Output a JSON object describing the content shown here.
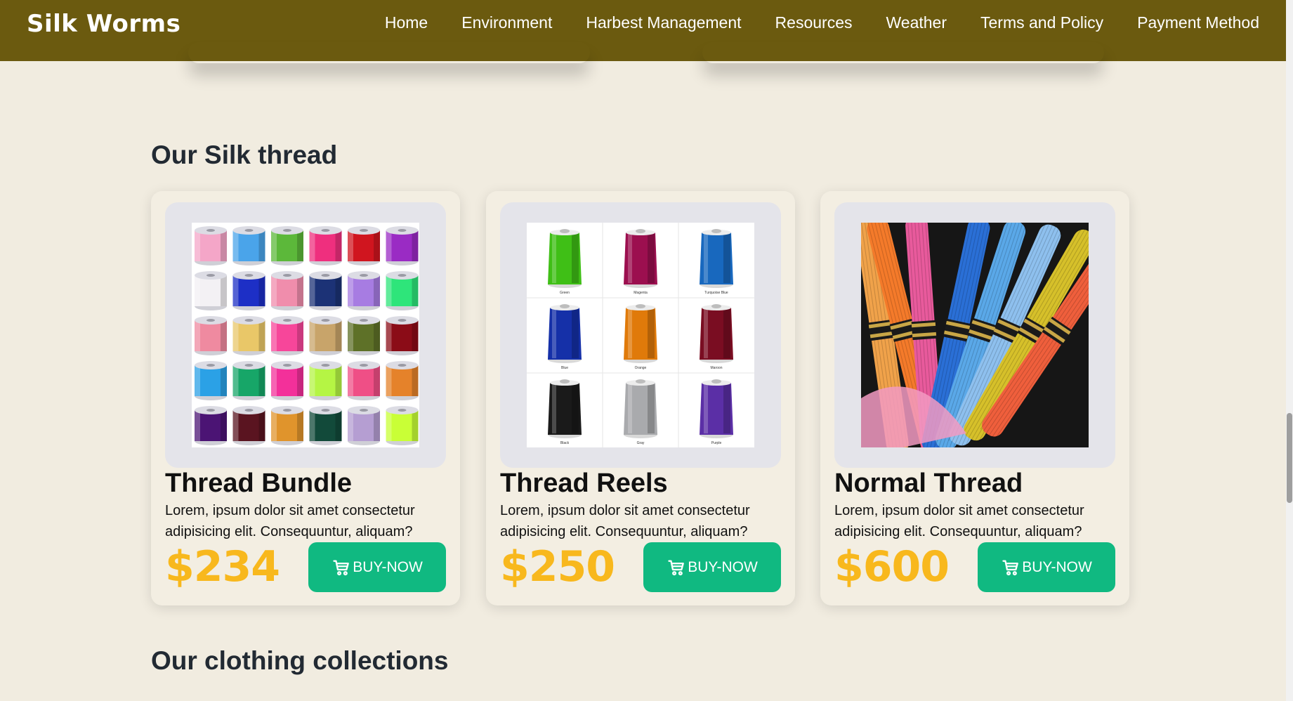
{
  "navbar": {
    "brand": "Silk Worms",
    "links": [
      "Home",
      "Environment",
      "Harbest Management",
      "Resources",
      "Weather",
      "Terms and Policy",
      "Payment Method"
    ]
  },
  "silk_section": {
    "title": "Our Silk thread",
    "products": [
      {
        "name": "Thread Bundle",
        "description": "Lorem, ipsum dolor sit amet consectetur adipisicing elit. Consequuntur, aliquam?",
        "price": "$234",
        "button_label": "BUY-NOW"
      },
      {
        "name": "Thread Reels",
        "description": "Lorem, ipsum dolor sit amet consectetur adipisicing elit. Consequuntur, aliquam?",
        "price": "$250",
        "button_label": "BUY-NOW"
      },
      {
        "name": "Normal Thread",
        "description": "Lorem, ipsum dolor sit amet consectetur adipisicing elit. Consequuntur, aliquam?",
        "price": "$600",
        "button_label": "BUY-NOW"
      }
    ]
  },
  "reel_labels": [
    "Green",
    "Magenta",
    "Turquoise Blue",
    "Blue",
    "Orange",
    "Maroon",
    "Black",
    "Gray",
    "Purple"
  ],
  "clothing_section": {
    "title": "Our clothing collections"
  },
  "colors": {
    "navbar": "#6b5a0f",
    "background": "#f1ece0",
    "price": "#f8b81d",
    "button": "#10b981"
  },
  "icons": {
    "cart": "cart-icon"
  }
}
